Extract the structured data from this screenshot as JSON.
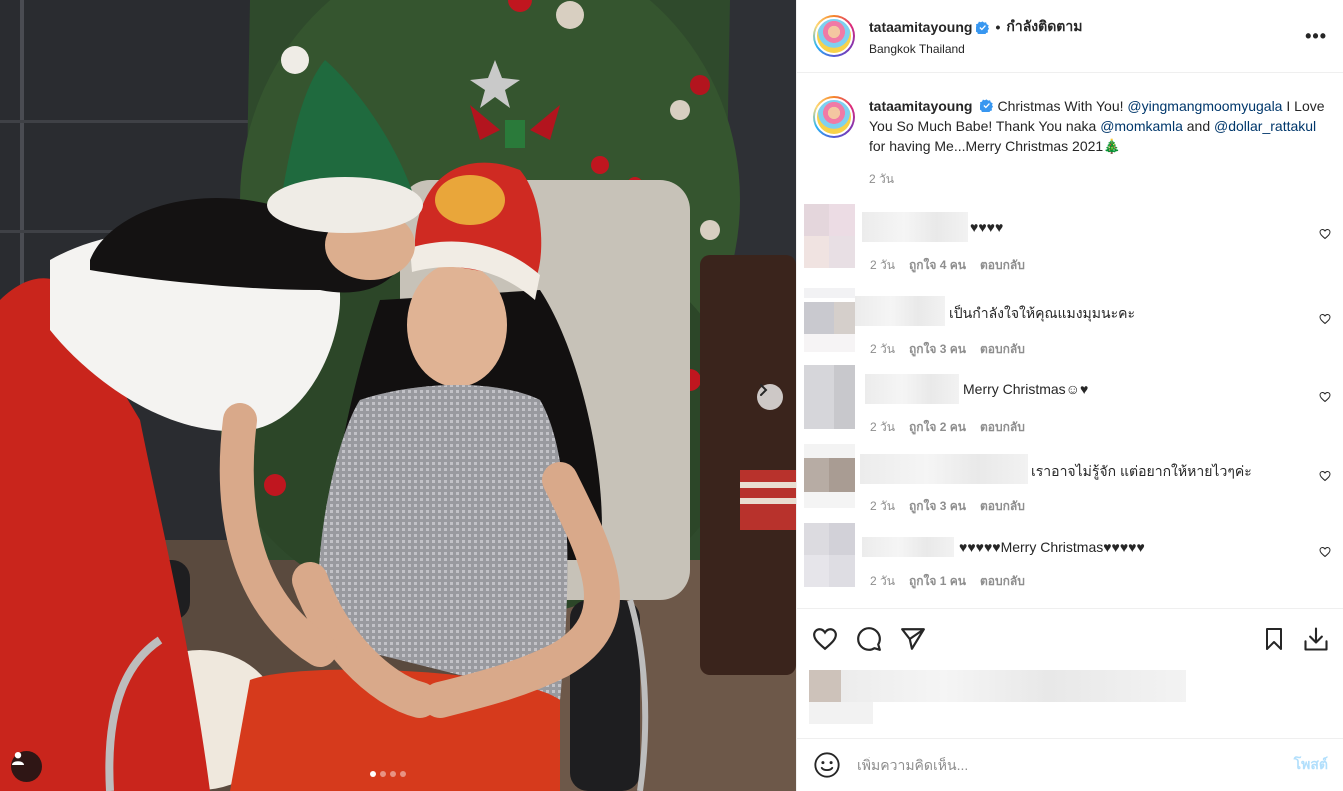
{
  "post": {
    "username": "tataamitayoung",
    "follow_status": "กำลังติดตาม",
    "location": "Bangkok Thailand",
    "more_label": "•••",
    "photo_alt": "Christmas photo"
  },
  "caption": {
    "username": "tataamitayoung",
    "parts": {
      "t1": "Christmas With You! ",
      "m1": "@yingmangmoomyugala",
      "t2": " I Love You So Much Babe! Thank You naka ",
      "m2": "@momkamla",
      "t3": " and ",
      "m3": "@dollar_rattakul",
      "t4": " for having Me...Merry Christmas 2021🎄"
    },
    "time": "2 วัน"
  },
  "comments": [
    {
      "text": "♥♥♥♥",
      "time": "2 วัน",
      "likes": "ถูกใจ 4 คน",
      "reply": "ตอบกลับ"
    },
    {
      "text": "เป็นกำลังใจให้คุณแมงมุมนะคะ",
      "time": "2 วัน",
      "likes": "ถูกใจ 3 คน",
      "reply": "ตอบกลับ"
    },
    {
      "text": "Merry Christmas☺♥",
      "time": "2 วัน",
      "likes": "ถูกใจ 2 คน",
      "reply": "ตอบกลับ"
    },
    {
      "text": "เราอาจไม่รู้จัก แต่อยากให้หายไวๆค่ะ",
      "time": "2 วัน",
      "likes": "ถูกใจ 3 คน",
      "reply": "ตอบกลับ"
    },
    {
      "text": "♥♥♥♥♥Merry Christmas♥♥♥♥♥",
      "time": "2 วัน",
      "likes": "ถูกใจ 1 คน",
      "reply": "ตอบกลับ"
    }
  ],
  "carousel": {
    "total": 4,
    "current": 1
  },
  "add_comment": {
    "placeholder": "เพิ่มความคิดเห็น...",
    "post_label": "โพสต์"
  },
  "colors": {
    "link": "#00376b",
    "verified": "#3897f0",
    "post_disabled": "#b2dffc",
    "muted": "#8e8e8e"
  }
}
